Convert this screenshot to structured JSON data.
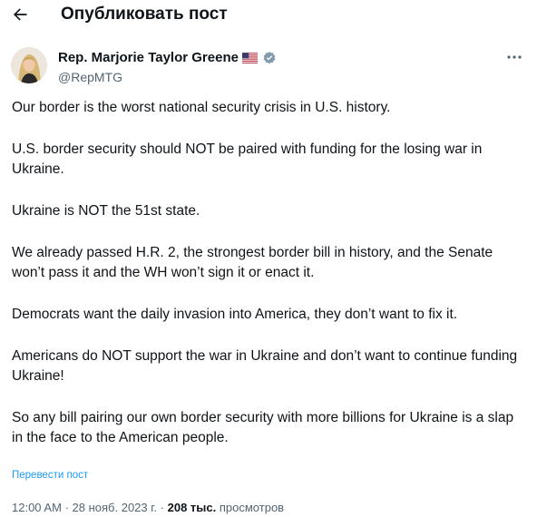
{
  "header": {
    "title": "Опубликовать пост",
    "back_icon": "arrow-left-icon"
  },
  "author": {
    "name": "Rep. Marjorie Taylor Greene",
    "handle": "@RepMTG",
    "flag_icon": "us-flag-icon",
    "verified_icon": "verified-badge-icon",
    "verified_color": "#829aab"
  },
  "more_icon": "more-horizontal-icon",
  "tweet": {
    "paragraphs": [
      "Our border is the worst national security crisis in U.S. history.",
      "U.S. border security should NOT be paired with funding for the losing war in Ukraine.",
      "Ukraine is NOT the 51st state.",
      "We already passed H.R. 2, the strongest border bill in history, and the Senate won’t pass it and the WH won’t sign it or enact it.",
      "Democrats want the daily invasion into America, they don’t want to fix it.",
      "Americans do NOT support the war in Ukraine and don’t want to continue funding Ukraine!",
      "So any bill pairing our own border security with more billions for Ukraine is a slap in the face to the American people."
    ],
    "translate_label": "Перевести пост"
  },
  "meta": {
    "time": "12:00 AM",
    "separator": "·",
    "date": "28 нояб. 2023 г.",
    "views_count": "208 тыс.",
    "views_label": "просмотров"
  },
  "colors": {
    "link": "#1d9bf0",
    "secondary_text": "#536471",
    "primary_text": "#0f1419"
  }
}
